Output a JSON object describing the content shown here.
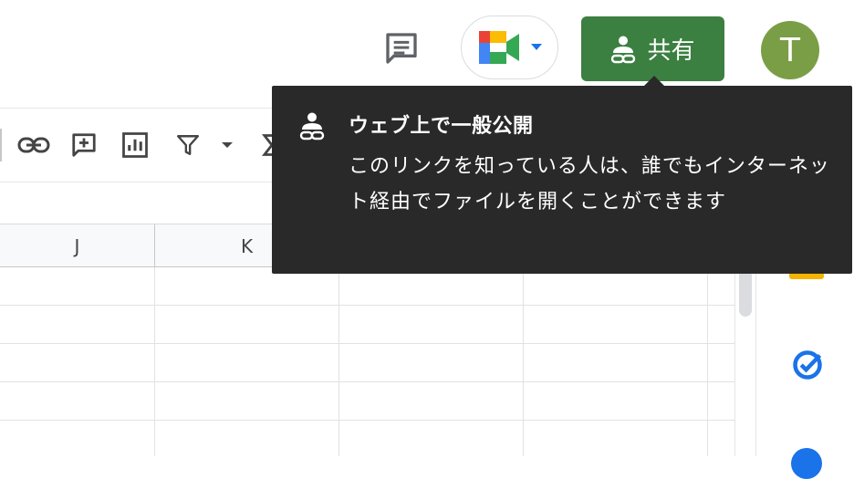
{
  "header": {
    "share_label": "共有",
    "avatar_letter": "T",
    "comment_icon": "comment-history-icon",
    "meet_icon": "google-meet-icon"
  },
  "toolbar": {
    "icons": [
      "insert-link-icon",
      "insert-comment-icon",
      "insert-chart-icon",
      "filter-icon",
      "dropdown-caret-icon",
      "functions-icon"
    ]
  },
  "grid": {
    "columns": [
      "J",
      "K"
    ]
  },
  "tooltip": {
    "title": "ウェブ上で一般公開",
    "body": "このリンクを知っている人は、誰でもインターネット経由でファイルを開くことができます"
  },
  "colors": {
    "share_bg": "#3b7f41",
    "avatar_bg": "#7a9e45",
    "tooltip_bg": "#292929"
  }
}
